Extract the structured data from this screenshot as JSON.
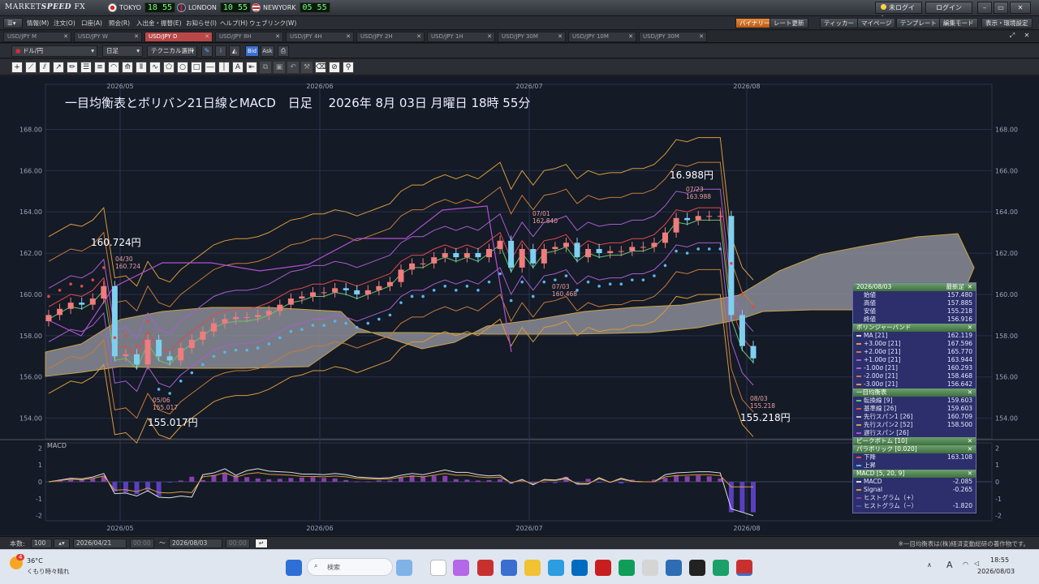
{
  "titlebar": {
    "logo_a": "MARKET",
    "logo_b": "SPEED",
    "logo_c": " FX",
    "cities": [
      {
        "name": "TOKYO",
        "time": "18 55"
      },
      {
        "name": "LONDON",
        "time": "10 55"
      },
      {
        "name": "NEWYORK",
        "time": "05 55"
      }
    ],
    "status_btn": "未ログイン",
    "login_btn": "ログイン"
  },
  "menu": {
    "items": [
      "情報(M)",
      "注文(O)",
      "口座(A)",
      "照会(R)",
      "入出金・振替(E)",
      "お知らせ(I)",
      "ヘルプ(H)",
      "ウェブリンク(W)"
    ],
    "right": [
      "バイナリー",
      "レート更新",
      "ティッカー",
      "マイページ",
      "テンプレート",
      "編集モード",
      "表示・環境設定"
    ]
  },
  "tabs": [
    "USD/JPY M",
    "USD/JPY W",
    "USD/JPY D",
    "USD/JPY 8H",
    "USD/JPY 4H",
    "USD/JPY 2H",
    "USD/JPY 1H",
    "USD/JPY 30M",
    "USD/JPY 10M",
    "USD/JPY 30M"
  ],
  "active_tab": 2,
  "toolbar": {
    "pair": "ドル/円",
    "period": "日足",
    "tech": "テクニカル選択",
    "bid": "Bid",
    "ask": "Ask"
  },
  "chart_data": {
    "type": "candlestick",
    "title": "一目均衡表とボリバン21日線とMACD　日足　 2026年 8月 03日 月曜日 18時 55分",
    "ylim": [
      153,
      169
    ],
    "y_ticks": [
      "168.00",
      "166.00",
      "164.00",
      "162.00",
      "160.00",
      "158.00",
      "156.00",
      "154.00"
    ],
    "x_ticks": [
      "2026/05",
      "2026/06",
      "2026/07",
      "2026/08"
    ],
    "macd_ticks": [
      "2",
      "1",
      "0",
      "-1",
      "-2"
    ],
    "macd_label": "MACD",
    "annotations": [
      {
        "price": "160.724円",
        "date": "04/30",
        "value": "160.724"
      },
      {
        "price": "155.017円",
        "date": "05/06",
        "value": "155.017"
      },
      {
        "price": "16.988円",
        "date": "07/23",
        "value": "163.988"
      },
      {
        "date": "07/01",
        "value": "162.840"
      },
      {
        "date": "07/03",
        "value": "160.468"
      },
      {
        "price": "155.218円",
        "date": "08/03",
        "value": "155.218"
      }
    ],
    "candles_close_trend": [
      159.0,
      159.3,
      159.6,
      159.5,
      159.8,
      160.4,
      157.0,
      157.1,
      156.6,
      157.8,
      157.0,
      156.8,
      157.4,
      157.8,
      158.2,
      158.6,
      158.8,
      158.9,
      158.9,
      159.0,
      159.2,
      159.5,
      159.8,
      159.9,
      160.1,
      160.1,
      160.3,
      160.2,
      160.0,
      160.2,
      160.4,
      160.6,
      161.2,
      161.5,
      161.5,
      161.8,
      162.0,
      161.8,
      162.0,
      161.8,
      162.2,
      162.6,
      161.3,
      162.2,
      161.5,
      162.2,
      162.3,
      162.5,
      161.8,
      162.2,
      162.0,
      162.1,
      162.1,
      162.3,
      162.3,
      162.5,
      163.0,
      163.7,
      163.6,
      163.8,
      163.8,
      163.8,
      159.0,
      157.5,
      156.9
    ]
  },
  "info_panel": {
    "header": "2026/08/03",
    "header_right": "最新足",
    "ohlc": [
      {
        "k": "始値",
        "v": "157.480"
      },
      {
        "k": "高値",
        "v": "157.885"
      },
      {
        "k": "安値",
        "v": "155.218"
      },
      {
        "k": "終値",
        "v": "156.916"
      }
    ],
    "bb_title": "ボリンジャーバンド",
    "bb": [
      {
        "k": "MA [21]",
        "v": "162.119",
        "c": "#d6d6d6"
      },
      {
        "k": "+3.00σ [21]",
        "v": "167.596",
        "c": "#d99a3c"
      },
      {
        "k": "+2.00σ [21]",
        "v": "165.770",
        "c": "#c77a3a"
      },
      {
        "k": "+1.00σ [21]",
        "v": "163.944",
        "c": "#a65fcf"
      },
      {
        "k": "-1.00σ [21]",
        "v": "160.293",
        "c": "#a65fcf"
      },
      {
        "k": "-2.00σ [21]",
        "v": "158.468",
        "c": "#c77a3a"
      },
      {
        "k": "-3.00σ [21]",
        "v": "156.642",
        "c": "#d99a3c"
      }
    ],
    "ichi_title": "一目均衡表",
    "ichi": [
      {
        "k": "転換線 [9]",
        "v": "159.603",
        "c": "#6ac26a"
      },
      {
        "k": "基準線 [26]",
        "v": "159.603",
        "c": "#e04a4a"
      },
      {
        "k": "先行スパン1 [26]",
        "v": "160.709",
        "c": "#c0c0c0"
      },
      {
        "k": "先行スパン2 [52]",
        "v": "158.500",
        "c": "#d99a3c"
      },
      {
        "k": "遅行スパン [26]",
        "v": "",
        "c": "#b050d0"
      }
    ],
    "peak_title": "ピークボトム [10]",
    "para_title": "パラボリック [0.020]",
    "para": [
      {
        "k": "下降",
        "v": "163.108",
        "c": "#e04a4a"
      },
      {
        "k": "上昇",
        "v": "",
        "c": "#5ab4f0"
      }
    ],
    "macd_title": "MACD [5, 20, 9]",
    "macd": [
      {
        "k": "MACD",
        "v": "-2.085",
        "c": "#e0e0e0"
      },
      {
        "k": "Signal",
        "v": "-0.265",
        "c": "#d99a3c"
      },
      {
        "k": "ヒストグラム（+）",
        "v": "",
        "c": "#8a3fb0"
      },
      {
        "k": "ヒストグラム（−）",
        "v": "-1.820",
        "c": "#5a3fc0"
      }
    ]
  },
  "bottom": {
    "count_label": "本数:",
    "count": "100",
    "from": "2026/04/21",
    "from_time": "00:00",
    "tilde": "〜",
    "to": "2026/08/03",
    "to_time": "00:00",
    "note": "※一目均衡表は(株)経済変動総研の著作物です。"
  },
  "taskbar": {
    "temp": "36°C",
    "weather": "くもり時々晴れ",
    "search": "検索",
    "time": "18:55",
    "date": "2026/08/03",
    "badge": "4"
  }
}
